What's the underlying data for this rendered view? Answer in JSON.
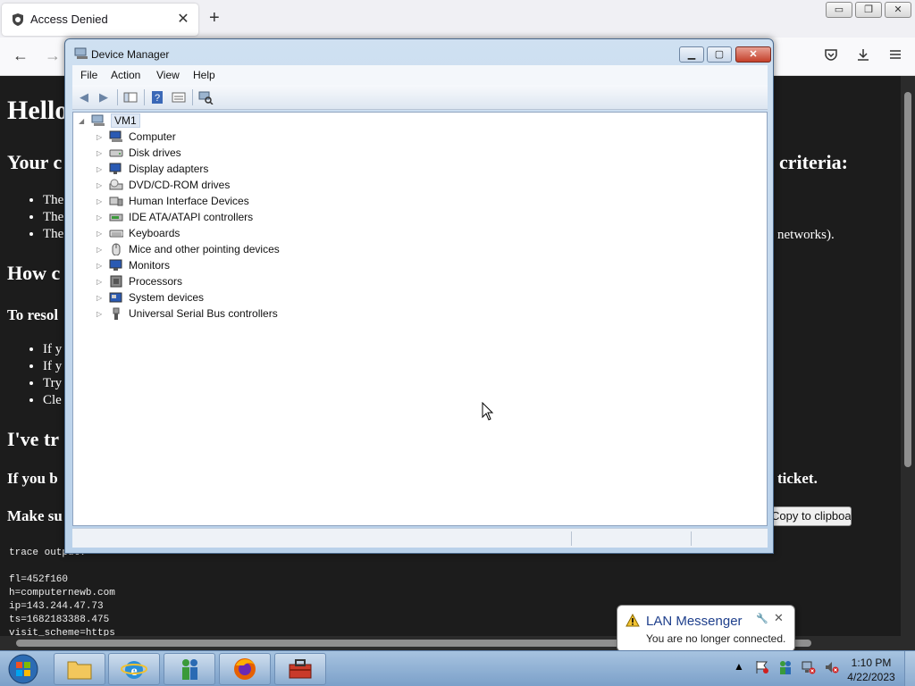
{
  "browser": {
    "tab_title": "Access Denied",
    "tab_close": "✕",
    "new_tab": "+",
    "win_min": "▭",
    "win_restore": "❐",
    "win_close": "✕",
    "nav_back": "←",
    "nav_forward": "→",
    "nav_icons": [
      "pocket-icon",
      "download-icon",
      "menu-icon"
    ]
  },
  "page": {
    "heading": "Hello",
    "section1_left": "Your c",
    "section1_right": "criteria:",
    "list1": [
      "The",
      "The",
      "The"
    ],
    "list1_tail": "networks).",
    "section2": "How c",
    "section2_sub": "To resol",
    "list2": [
      "If y",
      "If y",
      "Try",
      "Cle"
    ],
    "section3": "I've tr",
    "section3_sub_left": "If you b",
    "section3_sub_right": "ticket.",
    "section3_sub2": "Make su",
    "copy_button": "Copy to clipboard",
    "trace_lines": [
      "trace output:",
      "",
      "fl=452f160",
      "h=computernewb.com",
      "ip=143.244.47.73",
      "ts=1682183388.475",
      "visit_scheme=https"
    ]
  },
  "device_manager": {
    "title": "Device Manager",
    "menu": [
      "File",
      "Action",
      "View",
      "Help"
    ],
    "root": "VM1",
    "devices": [
      "Computer",
      "Disk drives",
      "Display adapters",
      "DVD/CD-ROM drives",
      "Human Interface Devices",
      "IDE ATA/ATAPI controllers",
      "Keyboards",
      "Mice and other pointing devices",
      "Monitors",
      "Processors",
      "System devices",
      "Universal Serial Bus controllers"
    ]
  },
  "notification": {
    "title": "LAN Messenger",
    "message": "You are no longer connected.",
    "close": "✕"
  },
  "taskbar": {
    "apps": [
      "file-explorer",
      "internet-explorer",
      "lan-messenger",
      "firefox",
      "device-manager"
    ],
    "clock_time": "1:10 PM",
    "clock_date": "4/22/2023"
  },
  "colors": {
    "page_bg": "#1c1c1c",
    "titlebar": "#c6dbf0",
    "close_red": "#c4402a",
    "toast_title": "#1e3f8c"
  }
}
